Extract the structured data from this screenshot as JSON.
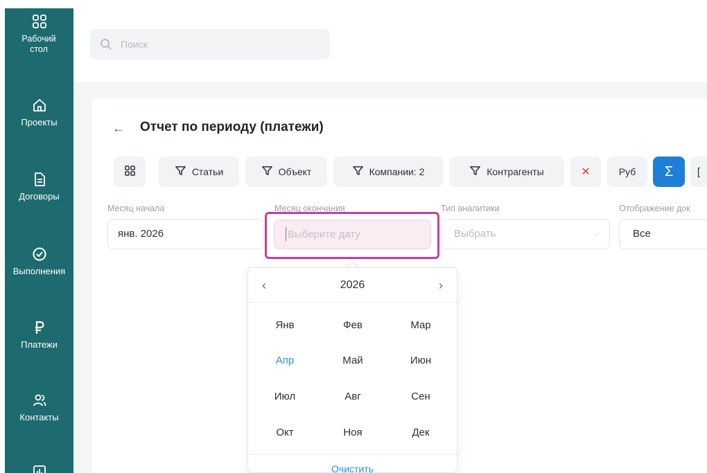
{
  "sidebar": {
    "items": [
      {
        "label": "Рабочий стол",
        "icon": "grid-icon"
      },
      {
        "label": "Проекты",
        "icon": "home-icon"
      },
      {
        "label": "Договоры",
        "icon": "document-icon"
      },
      {
        "label": "Выполнения",
        "icon": "check-circle-icon"
      },
      {
        "label": "Платежи",
        "icon": "ruble-icon"
      },
      {
        "label": "Контакты",
        "icon": "users-icon"
      },
      {
        "label": "",
        "icon": "chart-icon"
      }
    ]
  },
  "search": {
    "placeholder": "Поиск"
  },
  "page": {
    "title": "Отчет по периоду (платежи)"
  },
  "filters": {
    "articles": "Статьи",
    "object": "Объект",
    "companies": "Компании: 2",
    "counterparties": "Контрагенты",
    "clear_icon": "✕",
    "currency": "Руб",
    "sum_icon": "Σ"
  },
  "fields": {
    "start_month": {
      "label": "Месяц начала",
      "value": "янв. 2026"
    },
    "end_month": {
      "label": "Месяц окончания",
      "placeholder": "Выберите дату"
    },
    "analytics_type": {
      "label": "Тип аналитики",
      "placeholder": "Выбрать"
    },
    "display": {
      "label": "Отображение док",
      "value": "Все"
    }
  },
  "calendar": {
    "year": "2026",
    "months": [
      "Янв",
      "Фев",
      "Мар",
      "Апр",
      "Май",
      "Июн",
      "Июл",
      "Авг",
      "Сен",
      "Окт",
      "Ноя",
      "Дек"
    ],
    "current_month": "Апр",
    "clear_label": "Очистить"
  },
  "colors": {
    "sidebar": "#1e6b6f",
    "accent": "#1e7fd6",
    "highlight": "#c93d9b",
    "link": "#2a93d5"
  }
}
